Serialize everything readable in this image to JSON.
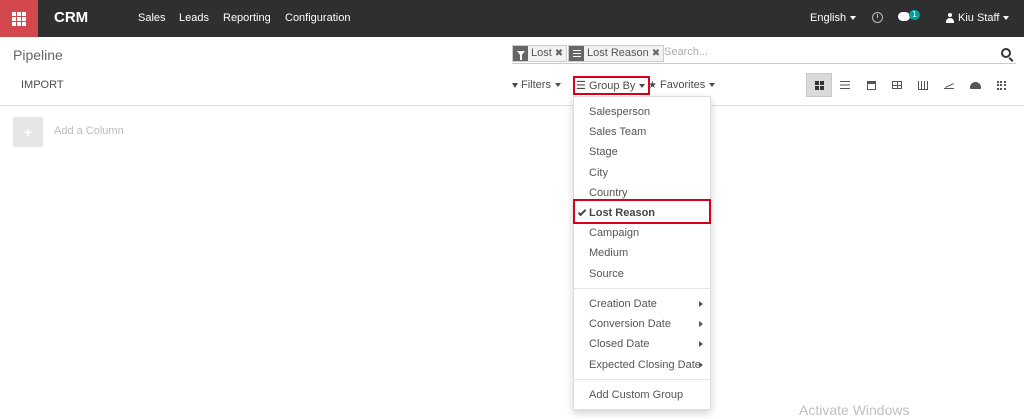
{
  "navbar": {
    "app_name": "CRM",
    "menu": [
      "Sales",
      "Leads",
      "Reporting",
      "Configuration"
    ],
    "language": "English",
    "message_count": "1",
    "user": "Kiu Staff"
  },
  "control_panel": {
    "breadcrumb": "Pipeline",
    "import_label": "IMPORT",
    "search": {
      "facets": [
        {
          "icon": "filter-icon",
          "label": "Lost"
        },
        {
          "icon": "group-icon",
          "label": "Lost Reason"
        }
      ],
      "placeholder": "Search..."
    },
    "buttons": {
      "filters": "Filters",
      "group_by": "Group By",
      "favorites": "Favorites"
    },
    "views": [
      "kanban",
      "list",
      "calendar",
      "pivot",
      "graph",
      "cohort",
      "dashboard",
      "grid"
    ]
  },
  "kanban": {
    "add_column_symbol": "+",
    "add_column_label": "Add a Column"
  },
  "group_by_menu": {
    "items": [
      "Salesperson",
      "Sales Team",
      "Stage",
      "City",
      "Country",
      "Lost Reason",
      "Campaign",
      "Medium",
      "Source"
    ],
    "selected": "Lost Reason",
    "date_items": [
      "Creation Date",
      "Conversion Date",
      "Closed Date",
      "Expected Closing Date"
    ],
    "custom": "Add Custom Group"
  },
  "watermark": "Activate Windows",
  "colors": {
    "navbar": "#2f2f2f",
    "brand_red": "#d2484c",
    "highlight": "#d9001b",
    "badge": "#00a09d"
  }
}
